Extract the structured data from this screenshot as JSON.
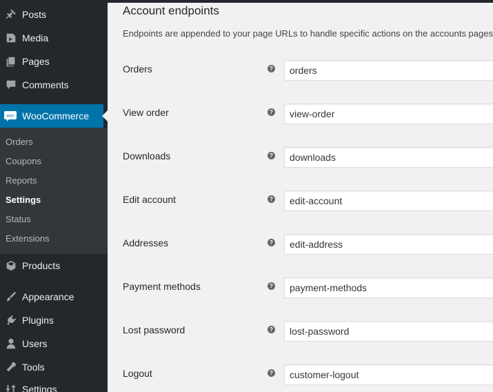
{
  "sidebar": {
    "top_items": [
      {
        "label": "Posts",
        "icon": "pin-icon"
      },
      {
        "label": "Media",
        "icon": "media-icon"
      },
      {
        "label": "Pages",
        "icon": "pages-icon"
      },
      {
        "label": "Comments",
        "icon": "comments-icon"
      }
    ],
    "woocommerce": {
      "label": "WooCommerce",
      "logo_text": "woo",
      "accent": "#0073aa"
    },
    "submenu": [
      {
        "label": "Orders",
        "current": false
      },
      {
        "label": "Coupons",
        "current": false
      },
      {
        "label": "Reports",
        "current": false
      },
      {
        "label": "Settings",
        "current": true
      },
      {
        "label": "Status",
        "current": false
      },
      {
        "label": "Extensions",
        "current": false
      }
    ],
    "bottom_items": [
      {
        "label": "Products",
        "icon": "products-icon"
      },
      {
        "label": "Appearance",
        "icon": "appearance-icon"
      },
      {
        "label": "Plugins",
        "icon": "plugins-icon"
      },
      {
        "label": "Users",
        "icon": "users-icon"
      },
      {
        "label": "Tools",
        "icon": "tools-icon"
      },
      {
        "label": "Settings",
        "icon": "settings-icon"
      }
    ]
  },
  "section": {
    "title": "Account endpoints",
    "description": "Endpoints are appended to your page URLs to handle specific actions on the accounts pages.",
    "help_glyph": "?"
  },
  "endpoints": [
    {
      "label": "Orders",
      "value": "orders"
    },
    {
      "label": "View order",
      "value": "view-order"
    },
    {
      "label": "Downloads",
      "value": "downloads"
    },
    {
      "label": "Edit account",
      "value": "edit-account"
    },
    {
      "label": "Addresses",
      "value": "edit-address"
    },
    {
      "label": "Payment methods",
      "value": "payment-methods"
    },
    {
      "label": "Lost password",
      "value": "lost-password"
    },
    {
      "label": "Logout",
      "value": "customer-logout"
    }
  ]
}
